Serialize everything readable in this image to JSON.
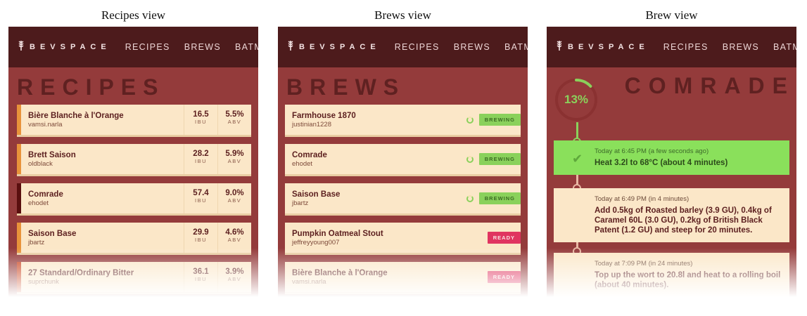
{
  "captions": {
    "recipes": "Recipes view",
    "brews": "Brews view",
    "brew": "Brew view"
  },
  "nav": {
    "brand": "BEVSPACE",
    "links": [
      "RECIPES",
      "BREWS",
      "BATMAN"
    ]
  },
  "recipes_view": {
    "title": "RECIPES",
    "ibu_unit": "IBU",
    "abv_unit": "ABV",
    "items": [
      {
        "name": "Bière Blanche à l'Orange",
        "user": "vamsi.narla",
        "ibu": "16.5",
        "abv": "5.5%",
        "color": "#e8933a"
      },
      {
        "name": "Brett Saison",
        "user": "oldblack",
        "ibu": "28.2",
        "abv": "5.9%",
        "color": "#e8933a"
      },
      {
        "name": "Comrade",
        "user": "ehodet",
        "ibu": "57.4",
        "abv": "9.0%",
        "color": "#5a0f0f"
      },
      {
        "name": "Saison Base",
        "user": "jbartz",
        "ibu": "29.9",
        "abv": "4.6%",
        "color": "#e8933a"
      },
      {
        "name": "27 Standard/Ordinary Bitter",
        "user": "suprchunk",
        "ibu": "36.1",
        "abv": "3.9%",
        "color": "#c9431e"
      }
    ]
  },
  "brews_view": {
    "title": "BREWS",
    "items": [
      {
        "name": "Farmhouse 1870",
        "user": "justinian1228",
        "status": "BREWING"
      },
      {
        "name": "Comrade",
        "user": "ehodet",
        "status": "BREWING"
      },
      {
        "name": "Saison Base",
        "user": "jbartz",
        "status": "BREWING"
      },
      {
        "name": "Pumpkin Oatmeal Stout",
        "user": "jeffreyyoung007",
        "status": "READY"
      },
      {
        "name": "Bière Blanche à l'Orange",
        "user": "vamsi.narla",
        "status": "READY"
      }
    ]
  },
  "brew_view": {
    "title": "COMRADE",
    "progress_label": "13%",
    "progress": 0.13,
    "steps": [
      {
        "time": "Today at 6:45 PM (a few seconds ago)",
        "desc": "Heat 3.2l to 68°C (about 4 minutes)",
        "done": true
      },
      {
        "time": "Today at 6:49 PM (in 4 minutes)",
        "desc": "Add 0.5kg of Roasted barley (3.9 GU), 0.4kg of Caramel 60L (3.0 GU), 0.2kg of British Black Patent (1.2 GU) and steep for 20 minutes.",
        "done": false
      },
      {
        "time": "Today at 7:09 PM (in 24 minutes)",
        "desc": "Top up the wort to 20.8l and heat to a rolling boil (about 40 minutes).",
        "done": false
      }
    ]
  },
  "colors": {
    "page_bg": "#943b3b",
    "navbar": "#4d1b1c",
    "card": "#fbe7c8",
    "brewing": "#8ad15b",
    "ready": "#e03460"
  }
}
